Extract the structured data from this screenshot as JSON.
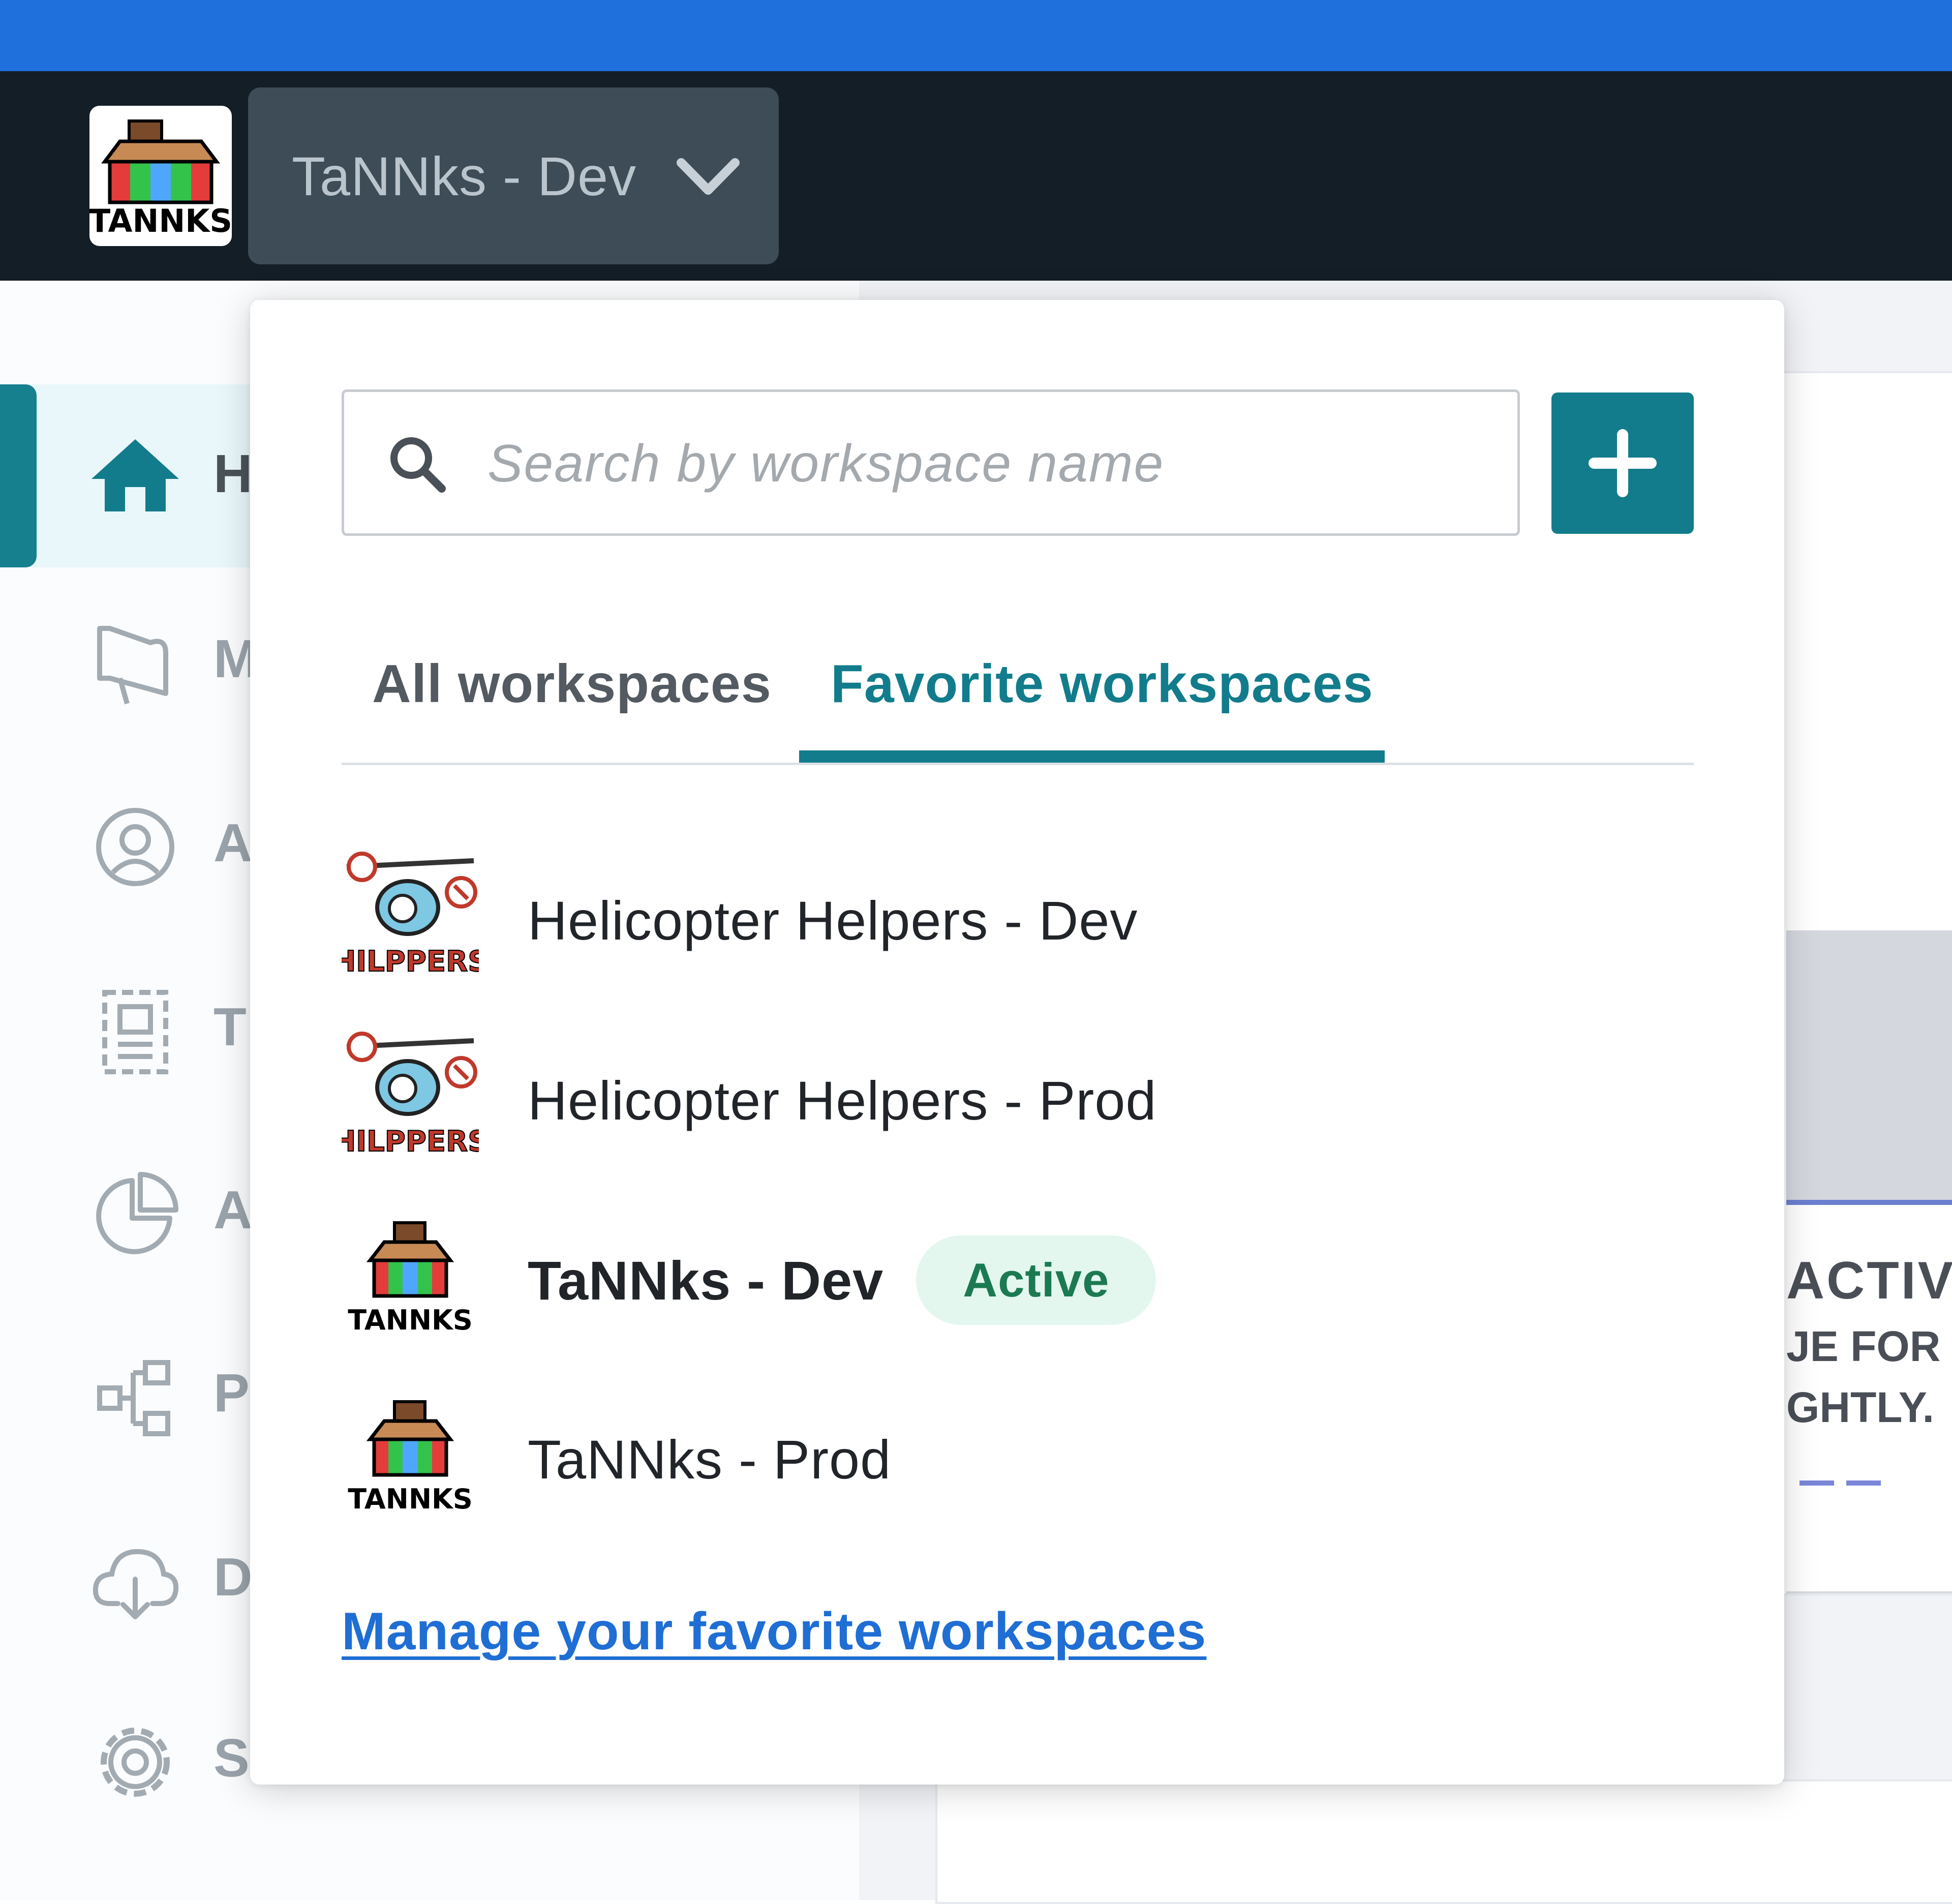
{
  "header": {
    "logo_text": "TANNKS",
    "workspace_switcher_label": "TaNNks - Dev",
    "switcher_icon": "chevron-down-icon"
  },
  "sidebar": {
    "items": [
      {
        "letter": "H",
        "icon": "home-icon",
        "active": true
      },
      {
        "letter": "M",
        "icon": "megaphone-icon"
      },
      {
        "letter": "A",
        "icon": "user-circle-icon"
      },
      {
        "letter": "T",
        "icon": "template-icon"
      },
      {
        "letter": "A",
        "icon": "pie-chart-icon"
      },
      {
        "letter": "P",
        "icon": "flow-icon"
      },
      {
        "letter": "D",
        "icon": "cloud-download-icon"
      },
      {
        "letter": "S",
        "icon": "gear-icon"
      }
    ]
  },
  "dropdown": {
    "search_placeholder": "Search by workspace name",
    "add_button_icon": "plus-icon",
    "tabs": [
      {
        "label": "All workspaces",
        "selected": false
      },
      {
        "label": "Favorite workspaces",
        "selected": true
      }
    ],
    "workspaces": [
      {
        "name": "Helicopter Helpers - Dev",
        "logo_text": "HILPPERS",
        "active": false
      },
      {
        "name": "Helicopter Helpers - Prod",
        "logo_text": "HILPPERS",
        "active": false
      },
      {
        "name": "TaNNks - Dev",
        "logo_text": "TANNKS",
        "active": true,
        "badge": "Active"
      },
      {
        "name": "TaNNks - Prod",
        "logo_text": "TANNKS",
        "active": false
      }
    ],
    "manage_link": "Manage your favorite workspaces"
  },
  "background": {
    "text_1": "ACTIV",
    "text_2": "JE FOR T",
    "text_3": "GHTLY."
  },
  "colors": {
    "top_bar": "#1f6fdc",
    "navbar": "#131e26",
    "accent": "#127c8c",
    "link": "#1f6ed4",
    "active_badge_bg": "#e3f7ef",
    "active_badge_text": "#1c7a52"
  }
}
